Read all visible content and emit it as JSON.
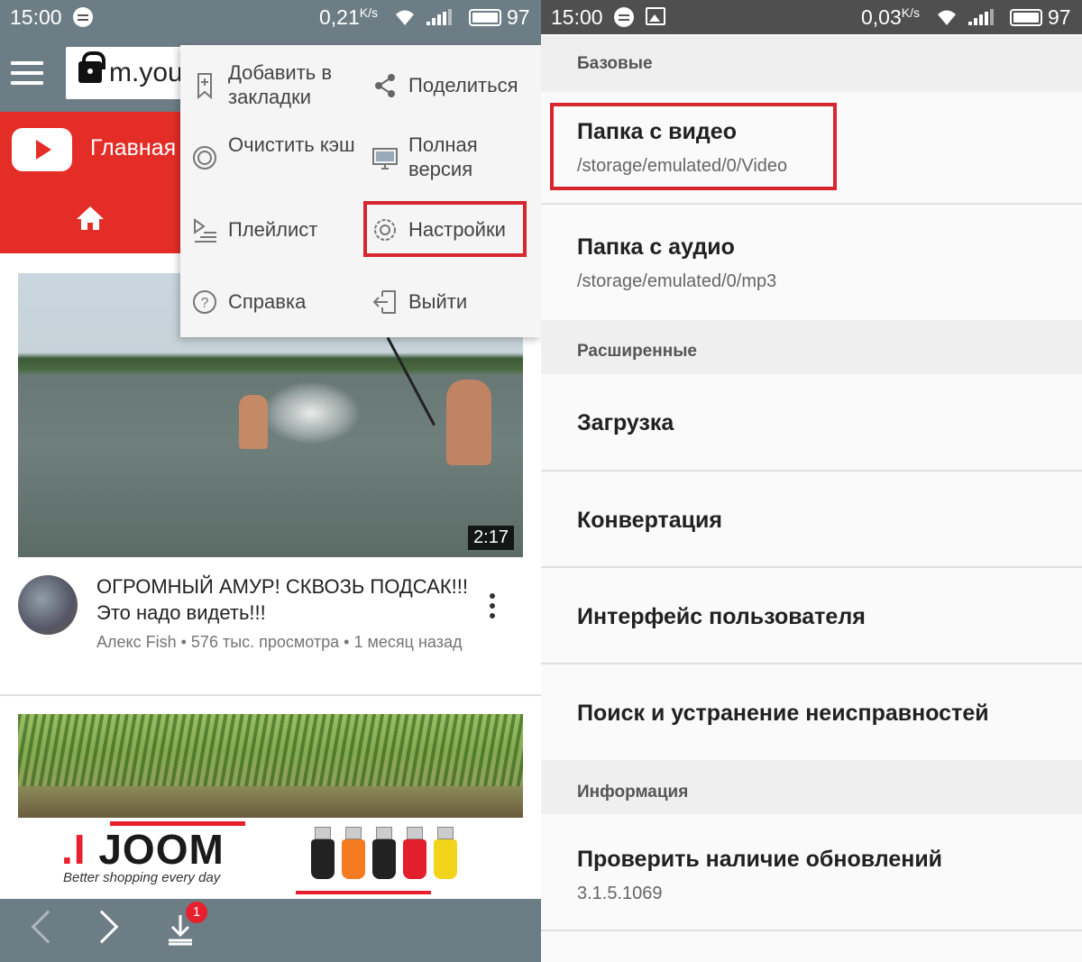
{
  "left_screen": {
    "status": {
      "time": "15:00",
      "speed": "0,21",
      "speed_unit": "K/s",
      "battery": "97"
    },
    "browser": {
      "url": "m.you"
    },
    "youtube": {
      "title": "Главная"
    },
    "menu": {
      "items": [
        {
          "label": "Добавить в закладки",
          "icon": "bookmark-icon"
        },
        {
          "label": "Поделиться",
          "icon": "share-icon"
        },
        {
          "label": "Очистить кэш",
          "icon": "clear-cache-icon"
        },
        {
          "label": "Полная версия",
          "icon": "desktop-icon"
        },
        {
          "label": "Плейлист",
          "icon": "playlist-icon"
        },
        {
          "label": "Настройки",
          "icon": "gear-icon"
        },
        {
          "label": "Справка",
          "icon": "help-icon"
        },
        {
          "label": "Выйти",
          "icon": "exit-icon"
        }
      ]
    },
    "video": {
      "duration": "2:17",
      "title": "ОГРОМНЫЙ АМУР! СКВОЗЬ ПОДСАК!!! Это надо видеть!!!",
      "channel": "Алекс Fish",
      "views": "576 тыс. просмотра",
      "age": "1 месяц назад"
    },
    "ad": {
      "brand": "JOOM",
      "tagline": "Better shopping every day"
    },
    "bottom": {
      "download_badge": "1"
    }
  },
  "right_screen": {
    "status": {
      "time": "15:00",
      "speed": "0,03",
      "speed_unit": "K/s",
      "battery": "97"
    },
    "sections": {
      "basic": "Базовые",
      "advanced": "Расширенные",
      "info": "Информация"
    },
    "settings": {
      "video_folder": {
        "title": "Папка с видео",
        "value": "/storage/emulated/0/Video"
      },
      "audio_folder": {
        "title": "Папка с аудио",
        "value": "/storage/emulated/0/mp3"
      },
      "download": {
        "title": "Загрузка"
      },
      "conversion": {
        "title": "Конвертация"
      },
      "ui": {
        "title": "Интерфейс пользователя"
      },
      "troubleshoot": {
        "title": "Поиск и устранение неисправностей"
      },
      "updates": {
        "title": "Проверить наличие обновлений",
        "value": "3.1.5.1069"
      }
    }
  },
  "colors": {
    "highlight": "#d7262f",
    "youtube_red": "#e52d27",
    "toolbar": "#6d7d86"
  }
}
